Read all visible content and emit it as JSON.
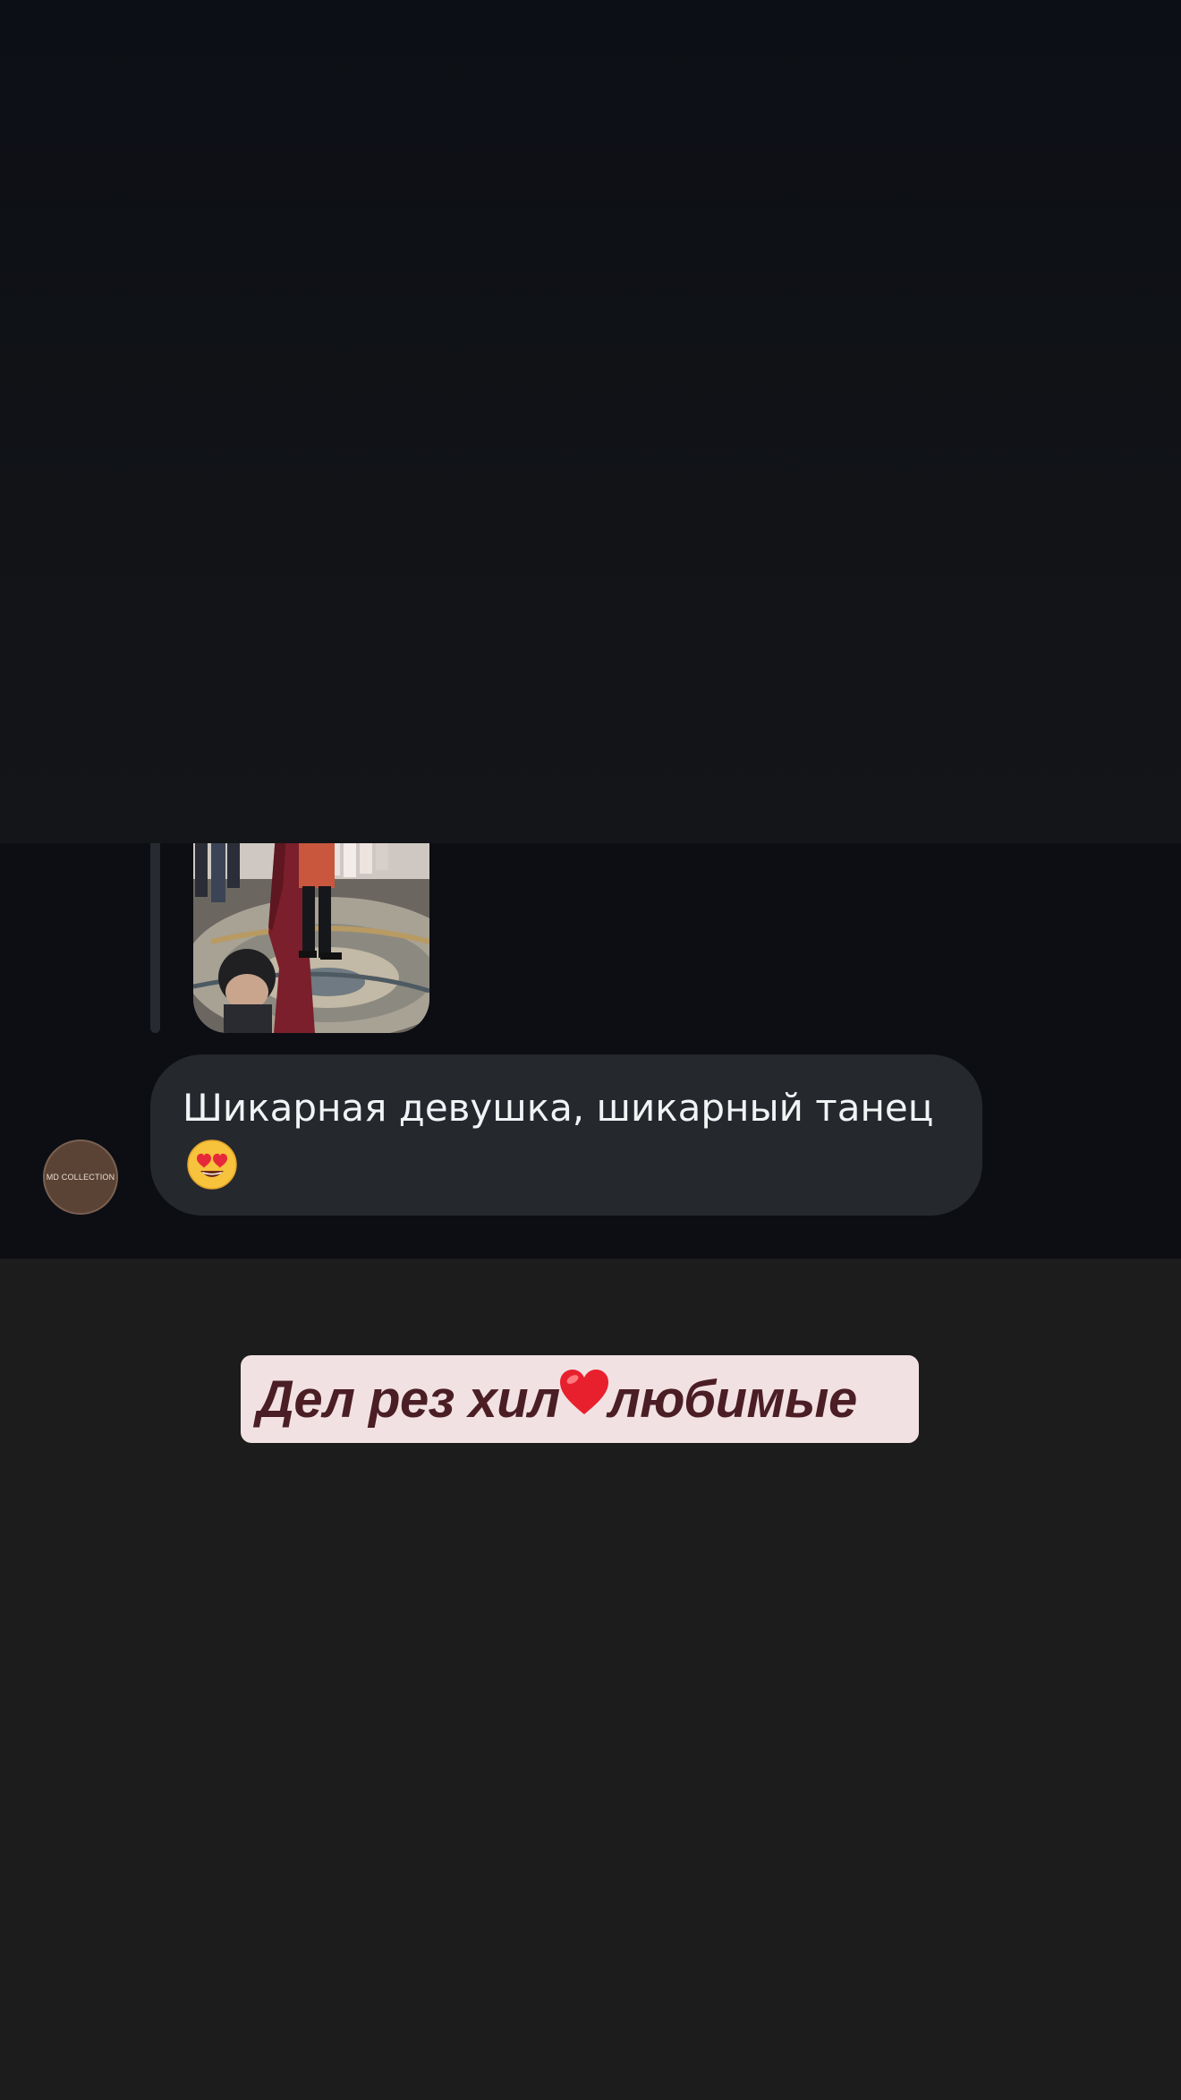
{
  "message": {
    "text": "Шикарная девушка, шикарный танец",
    "emoji": "heart-eyes-face-icon"
  },
  "sender": {
    "avatar_label": "MD COLLECTION"
  },
  "caption": {
    "part1": "Дел рез хил",
    "heart": "heart-icon",
    "part2": "любимые"
  },
  "colors": {
    "panel_bg": "#0c0e13",
    "bubble_bg": "#25282d",
    "caption_bg": "#f2e1e2",
    "caption_text": "#4a1e24",
    "page_bg": "#1c1c1d"
  }
}
